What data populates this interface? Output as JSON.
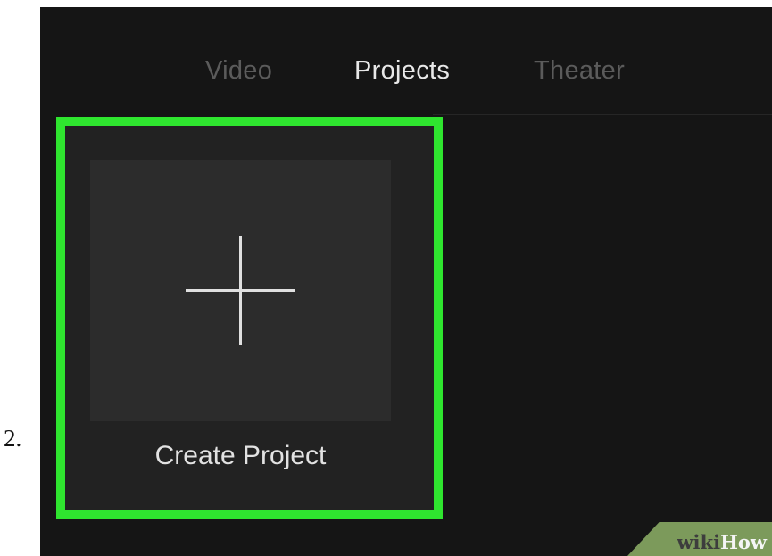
{
  "step": {
    "number": "2."
  },
  "tabs": [
    {
      "label": "Video",
      "active": false
    },
    {
      "label": "Projects",
      "active": true
    },
    {
      "label": "Theater",
      "active": false
    }
  ],
  "project_card": {
    "label": "Create Project",
    "icon": "plus-icon",
    "highlighted": true
  },
  "watermark": {
    "wiki": "wiki",
    "how": "How"
  },
  "colors": {
    "background": "#151515",
    "card": "#222222",
    "thumbnail": "#2c2c2c",
    "highlight": "#2fe52f",
    "active_tab": "#e8e8e8",
    "inactive_tab": "#5b5b5b",
    "watermark_bg": "#7c9a5b"
  }
}
